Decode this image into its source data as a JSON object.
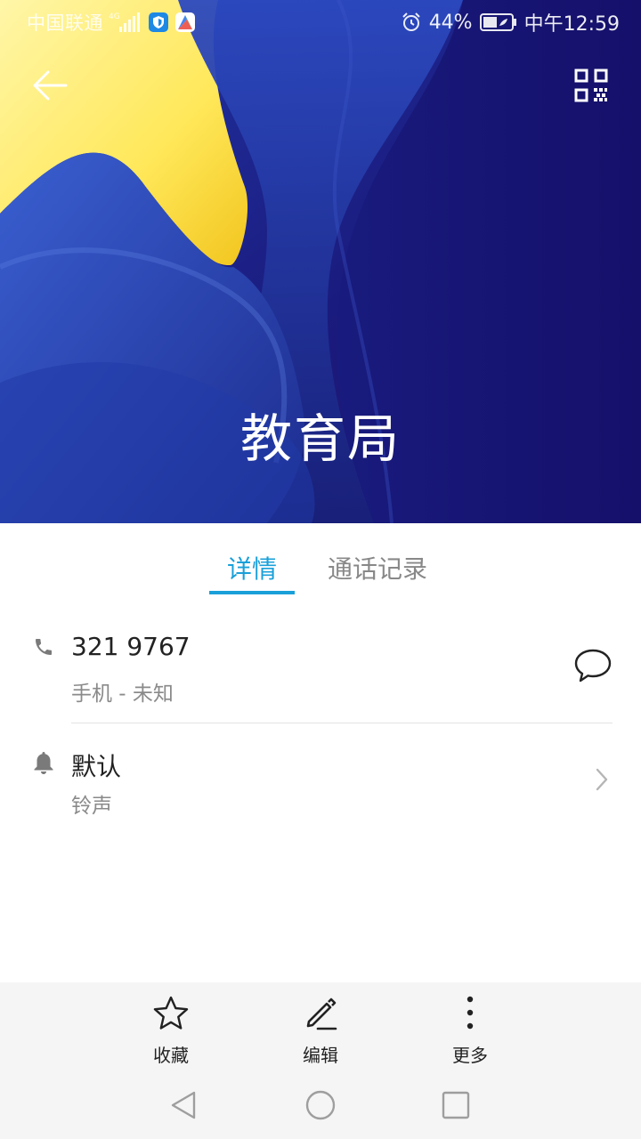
{
  "status_bar": {
    "carrier": "中国联通",
    "network": "4G",
    "battery_percent": "44%",
    "time": "中午12:59",
    "icons": [
      "signal-icon",
      "shield-app-icon",
      "maps-app-icon",
      "alarm-icon",
      "battery-icon"
    ]
  },
  "header": {
    "back_icon": "back-arrow-icon",
    "qr_icon": "qr-code-icon",
    "contact_name": "教育局",
    "background_colors": [
      "#fff27a",
      "#1f2f9a",
      "#1a1470"
    ]
  },
  "tabs": [
    {
      "label": "详情",
      "selected": true
    },
    {
      "label": "通话记录",
      "selected": false
    }
  ],
  "details": {
    "phone": {
      "icon": "phone-icon",
      "number": "321 9767",
      "label": "手机 - 未知",
      "action_icon": "message-bubble-icon"
    },
    "ringtone": {
      "icon": "bell-icon",
      "value": "默认",
      "label": "铃声",
      "action_icon": "chevron-right-icon"
    }
  },
  "actions": [
    {
      "label": "收藏",
      "icon": "star-outline-icon"
    },
    {
      "label": "编辑",
      "icon": "pencil-icon"
    },
    {
      "label": "更多",
      "icon": "more-vertical-icon"
    }
  ],
  "nav_bar": {
    "icons": [
      "nav-back-icon",
      "nav-home-icon",
      "nav-recents-icon"
    ]
  },
  "colors": {
    "accent": "#1aa0d9",
    "primary_text": "#222222",
    "secondary_text": "#8a8a8a",
    "bar_background": "#f5f5f5"
  }
}
